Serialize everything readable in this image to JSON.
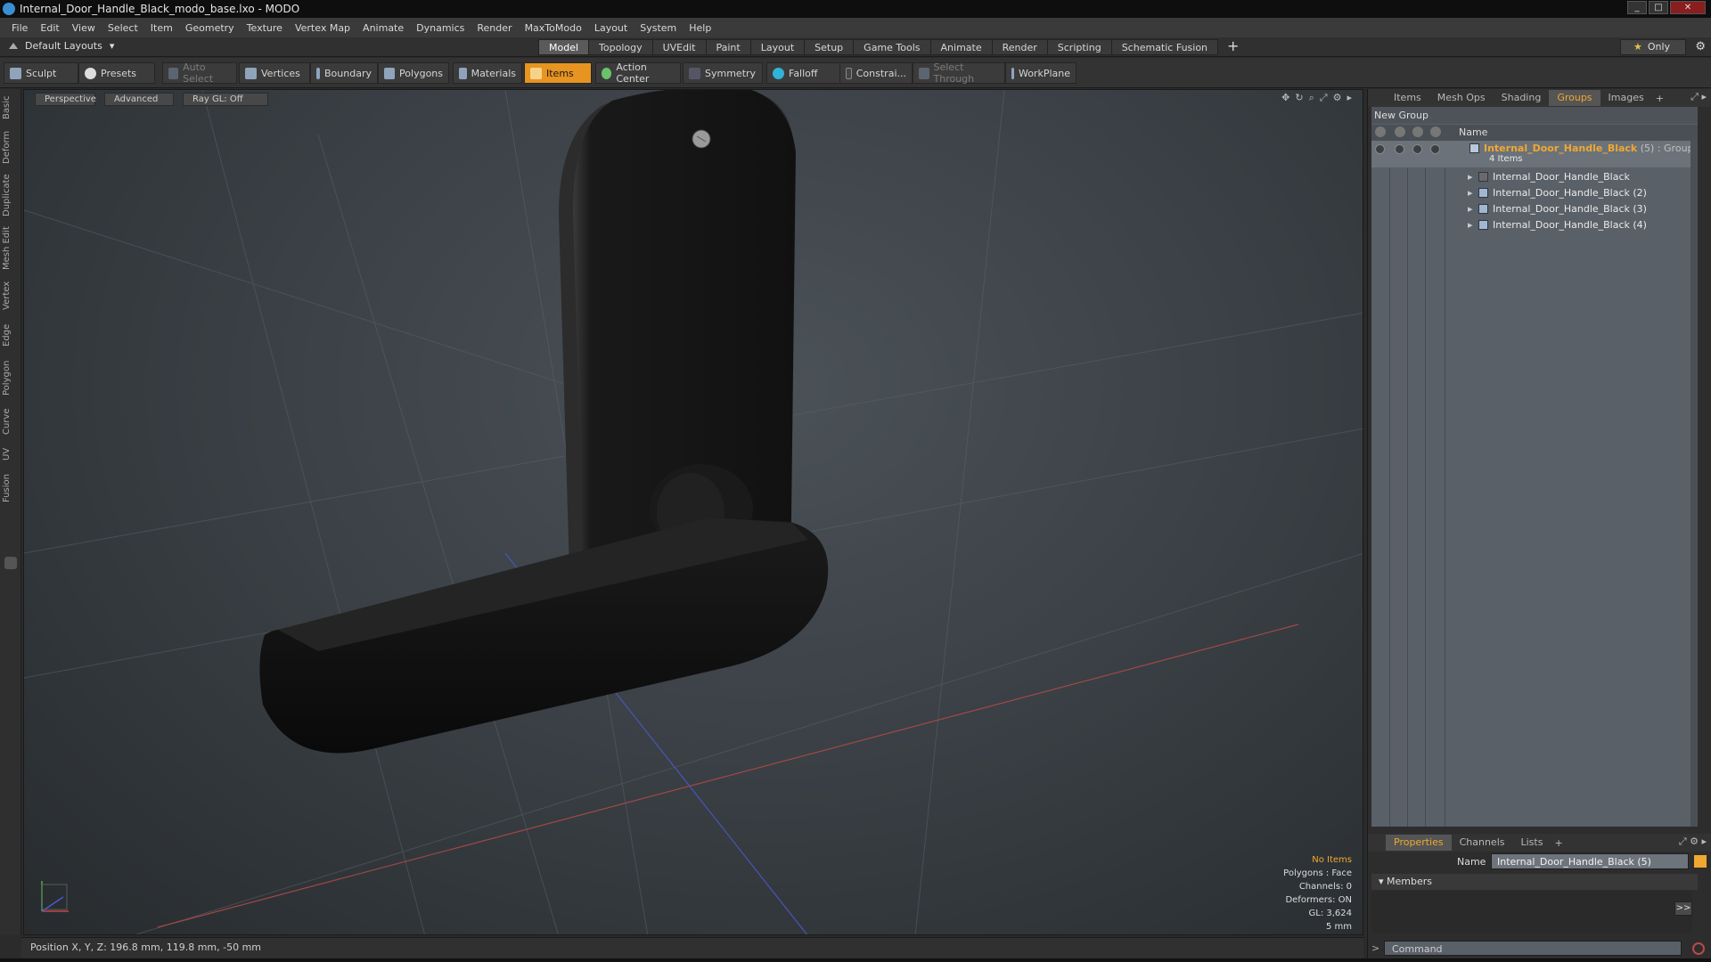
{
  "window": {
    "title": "Internal_Door_Handle_Black_modo_base.lxo - MODO"
  },
  "menu": [
    "File",
    "Edit",
    "View",
    "Select",
    "Item",
    "Geometry",
    "Texture",
    "Vertex Map",
    "Animate",
    "Dynamics",
    "Render",
    "MaxToModo",
    "Layout",
    "System",
    "Help"
  ],
  "layouts": {
    "label": "Default Layouts"
  },
  "tabs": [
    {
      "label": "Model",
      "active": true
    },
    {
      "label": "Topology"
    },
    {
      "label": "UVEdit"
    },
    {
      "label": "Paint"
    },
    {
      "label": "Layout"
    },
    {
      "label": "Setup"
    },
    {
      "label": "Game Tools"
    },
    {
      "label": "Animate"
    },
    {
      "label": "Render"
    },
    {
      "label": "Scripting"
    },
    {
      "label": "Schematic Fusion"
    }
  ],
  "only_label": "Only",
  "toolbar": {
    "sculpt": "Sculpt",
    "presets": "Presets",
    "auto_select": "Auto Select",
    "vertices": "Vertices",
    "boundary": "Boundary",
    "polygons": "Polygons",
    "materials": "Materials",
    "items": "Items",
    "action_center": "Action Center",
    "symmetry": "Symmetry",
    "falloff": "Falloff",
    "constrain": "Constrai...",
    "select_through": "Select Through",
    "workplane": "WorkPlane"
  },
  "left_tabs": [
    "Basic",
    "Deform",
    "Duplicate",
    "Mesh Edit",
    "Vertex",
    "Edge",
    "Polygon",
    "Curve",
    "UV",
    "Fusion"
  ],
  "viewport": {
    "perspective": "Perspective",
    "advanced": "Advanced",
    "raygl": "Ray GL: Off",
    "info": {
      "no_items": "No Items",
      "polygons": "Polygons : Face",
      "channels": "Channels: 0",
      "deformers": "Deformers: ON",
      "gl": "GL: 3,624",
      "scale": "5 mm"
    }
  },
  "status": {
    "position": "Position X, Y, Z:  196.8 mm, 119.8 mm, -50 mm"
  },
  "right_tabs": [
    "Items",
    "Mesh Ops",
    "Shading",
    "Groups",
    "Images"
  ],
  "groups": {
    "new_group": "New Group",
    "name_header": "Name",
    "group_name": "Internal_Door_Handle_Black",
    "group_type": "(5) : Group",
    "group_count": "4 Items",
    "items": [
      "Internal_Door_Handle_Black",
      "Internal_Door_Handle_Black (2)",
      "Internal_Door_Handle_Black (3)",
      "Internal_Door_Handle_Black (4)"
    ]
  },
  "props_tabs": [
    "Properties",
    "Channels",
    "Lists"
  ],
  "props": {
    "name_label": "Name",
    "name_value": "Internal_Door_Handle_Black (5)",
    "members": "Members",
    "command_placeholder": "Command"
  },
  "colors": {
    "accent": "#f0a830",
    "items_button": "#e79420",
    "viewport_bg": "#3b4146"
  }
}
